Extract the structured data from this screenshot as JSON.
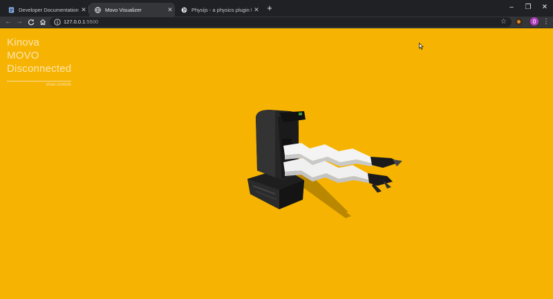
{
  "browser": {
    "tabs": [
      {
        "label": "Developer Documentation - Goo",
        "icon": "docs-icon",
        "active": false
      },
      {
        "label": "Movo Visualizer",
        "icon": "globe-icon",
        "active": true
      },
      {
        "label": "Physijs - a physics plugin for thre",
        "icon": "globe-icon",
        "active": false
      }
    ],
    "new_tab_symbol": "+",
    "address": {
      "host": "127.0.0.1",
      "port": ":5500"
    },
    "controls": {
      "minimize": "–",
      "restore": "❐",
      "close": "✕"
    }
  },
  "page": {
    "hud": {
      "title": "Kinova MOVO",
      "status": "Disconnected",
      "toggle_link": "show controls"
    },
    "background_color": "#f6b301",
    "scene": "movo-robot-3d-view"
  }
}
